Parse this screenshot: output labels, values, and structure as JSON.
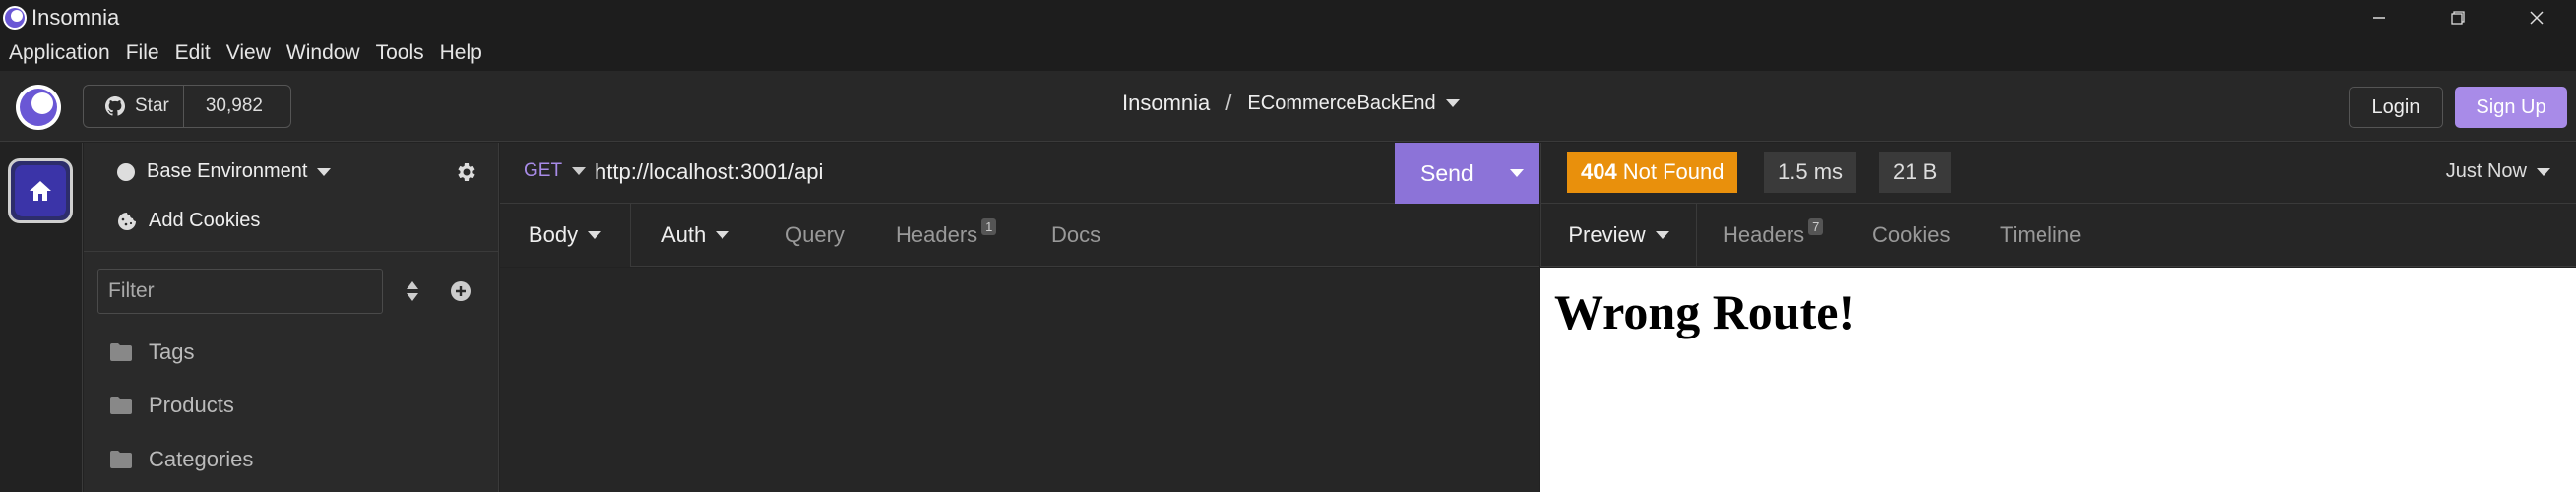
{
  "window": {
    "title": "Insomnia",
    "controls": [
      "minimize",
      "restore",
      "close"
    ]
  },
  "menu": {
    "items": [
      "Application",
      "File",
      "Edit",
      "View",
      "Window",
      "Tools",
      "Help"
    ]
  },
  "header": {
    "github": {
      "star_label": "Star",
      "star_count": "30,982"
    },
    "breadcrumb": {
      "project": "Insomnia",
      "separator": "/",
      "document": "ECommerceBackEnd"
    },
    "login_label": "Login",
    "signup_label": "Sign Up"
  },
  "sidebar": {
    "environment": "Base Environment",
    "cookies_label": "Add Cookies",
    "filter_placeholder": "Filter",
    "folders": [
      "Tags",
      "Products",
      "Categories"
    ]
  },
  "request": {
    "method": "GET",
    "url": "http://localhost:3001/api",
    "send_label": "Send",
    "tabs": {
      "body": "Body",
      "auth": "Auth",
      "query": "Query",
      "headers": "Headers",
      "headers_count": "1",
      "docs": "Docs"
    }
  },
  "response": {
    "status_code": "404",
    "status_text": "Not Found",
    "time": "1.5 ms",
    "size": "21 B",
    "history": "Just Now",
    "tabs": {
      "preview": "Preview",
      "headers": "Headers",
      "headers_count": "7",
      "cookies": "Cookies",
      "timeline": "Timeline"
    },
    "preview_heading": "Wrong Route!"
  },
  "colors": {
    "accent": "#8c73d8",
    "signup": "#a88be8",
    "status_404": "#e9900c"
  }
}
